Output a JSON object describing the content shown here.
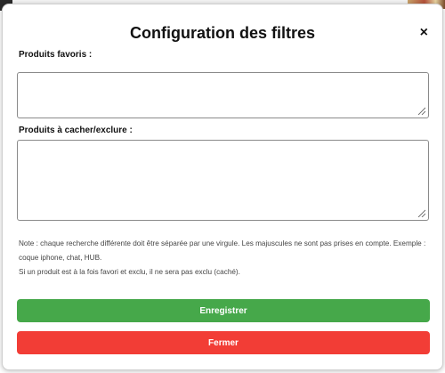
{
  "dialog": {
    "title": "Configuration des filtres",
    "close_symbol": "×"
  },
  "fields": {
    "favorites": {
      "label": "Produits favoris :",
      "value": ""
    },
    "exclude": {
      "label": "Produits à cacher/exclure :",
      "value": ""
    }
  },
  "note": {
    "line1": "Note : chaque recherche différente doit être séparée par une virgule. Les majuscules ne sont pas prises en compte. Exemple : coque iphone, chat, HUB.",
    "line2": "Si un produit est à la fois favori et exclu, il ne sera pas exclu (caché)."
  },
  "buttons": {
    "save_label": "Enregistrer",
    "close_label": "Fermer"
  },
  "colors": {
    "save": "#46a84a",
    "close": "#f23d36"
  },
  "icons": {
    "close": "close-icon",
    "resize": "resize-grip-icon"
  }
}
